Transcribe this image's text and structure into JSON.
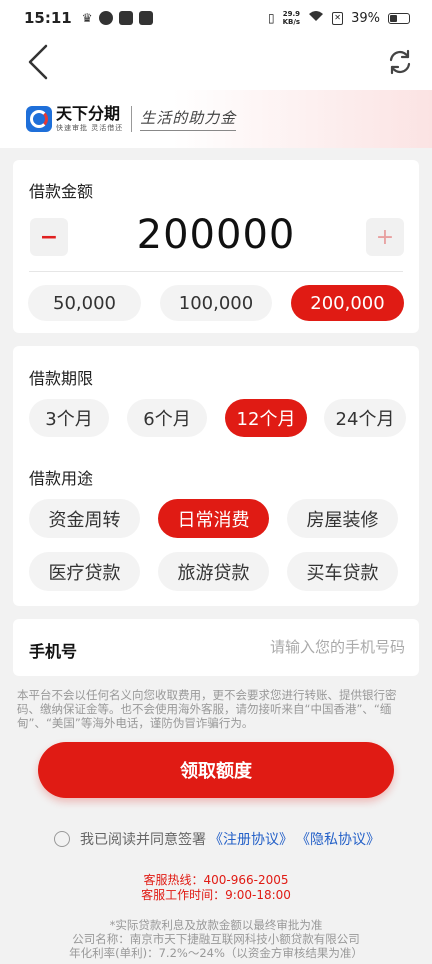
{
  "status_bar": {
    "time": "15:11",
    "net_speed_value": "29.9",
    "net_speed_unit": "KB/s",
    "battery_text": "39%"
  },
  "brand": {
    "logo_name": "天下分期",
    "logo_sub": "快速审批  灵活借还",
    "slogan": "生活的助力金"
  },
  "amount": {
    "title": "借款金额",
    "minus": "−",
    "plus": "+",
    "value": "200000",
    "options": [
      "50,000",
      "100,000",
      "200,000"
    ],
    "selected_index": 2
  },
  "term": {
    "title": "借款期限",
    "options": [
      "3个月",
      "6个月",
      "12个月",
      "24个月"
    ],
    "selected_index": 2
  },
  "purpose": {
    "title": "借款用途",
    "options": [
      "资金周转",
      "日常消费",
      "房屋装修",
      "医疗贷款",
      "旅游贷款",
      "买车贷款"
    ],
    "selected_index": 1
  },
  "phone": {
    "label": "手机号",
    "placeholder": "请输入您的手机号码",
    "value": ""
  },
  "notice": "本平台不会以任何名义向您收取费用，更不会要求您进行转账、提供银行密码、缴纳保证金等。也不会使用海外客服，请勿接听来自“中国香港”、“缅甸”、“美国”等海外电话，谨防伪冒诈骗行为。",
  "cta_label": "领取额度",
  "agreement": {
    "prefix": "我已阅读并同意签署",
    "register": "《注册协议》",
    "privacy": "《隐私协议》"
  },
  "contact": {
    "hotline": "客服热线：400-966-2005",
    "hours": "客服工作时间：9:00-18:00"
  },
  "footer": {
    "disclaimer": "*实际贷款利息及放款金额以最终审批为准",
    "company": "公司名称：南京市天下捷融互联网科技小额贷款有限公司",
    "rate": "年化利率(单利)：7.2%～24%（以资金方审核结果为准）"
  },
  "colors": {
    "accent": "#e01b14",
    "link": "#2561c8",
    "muted": "#999999"
  }
}
